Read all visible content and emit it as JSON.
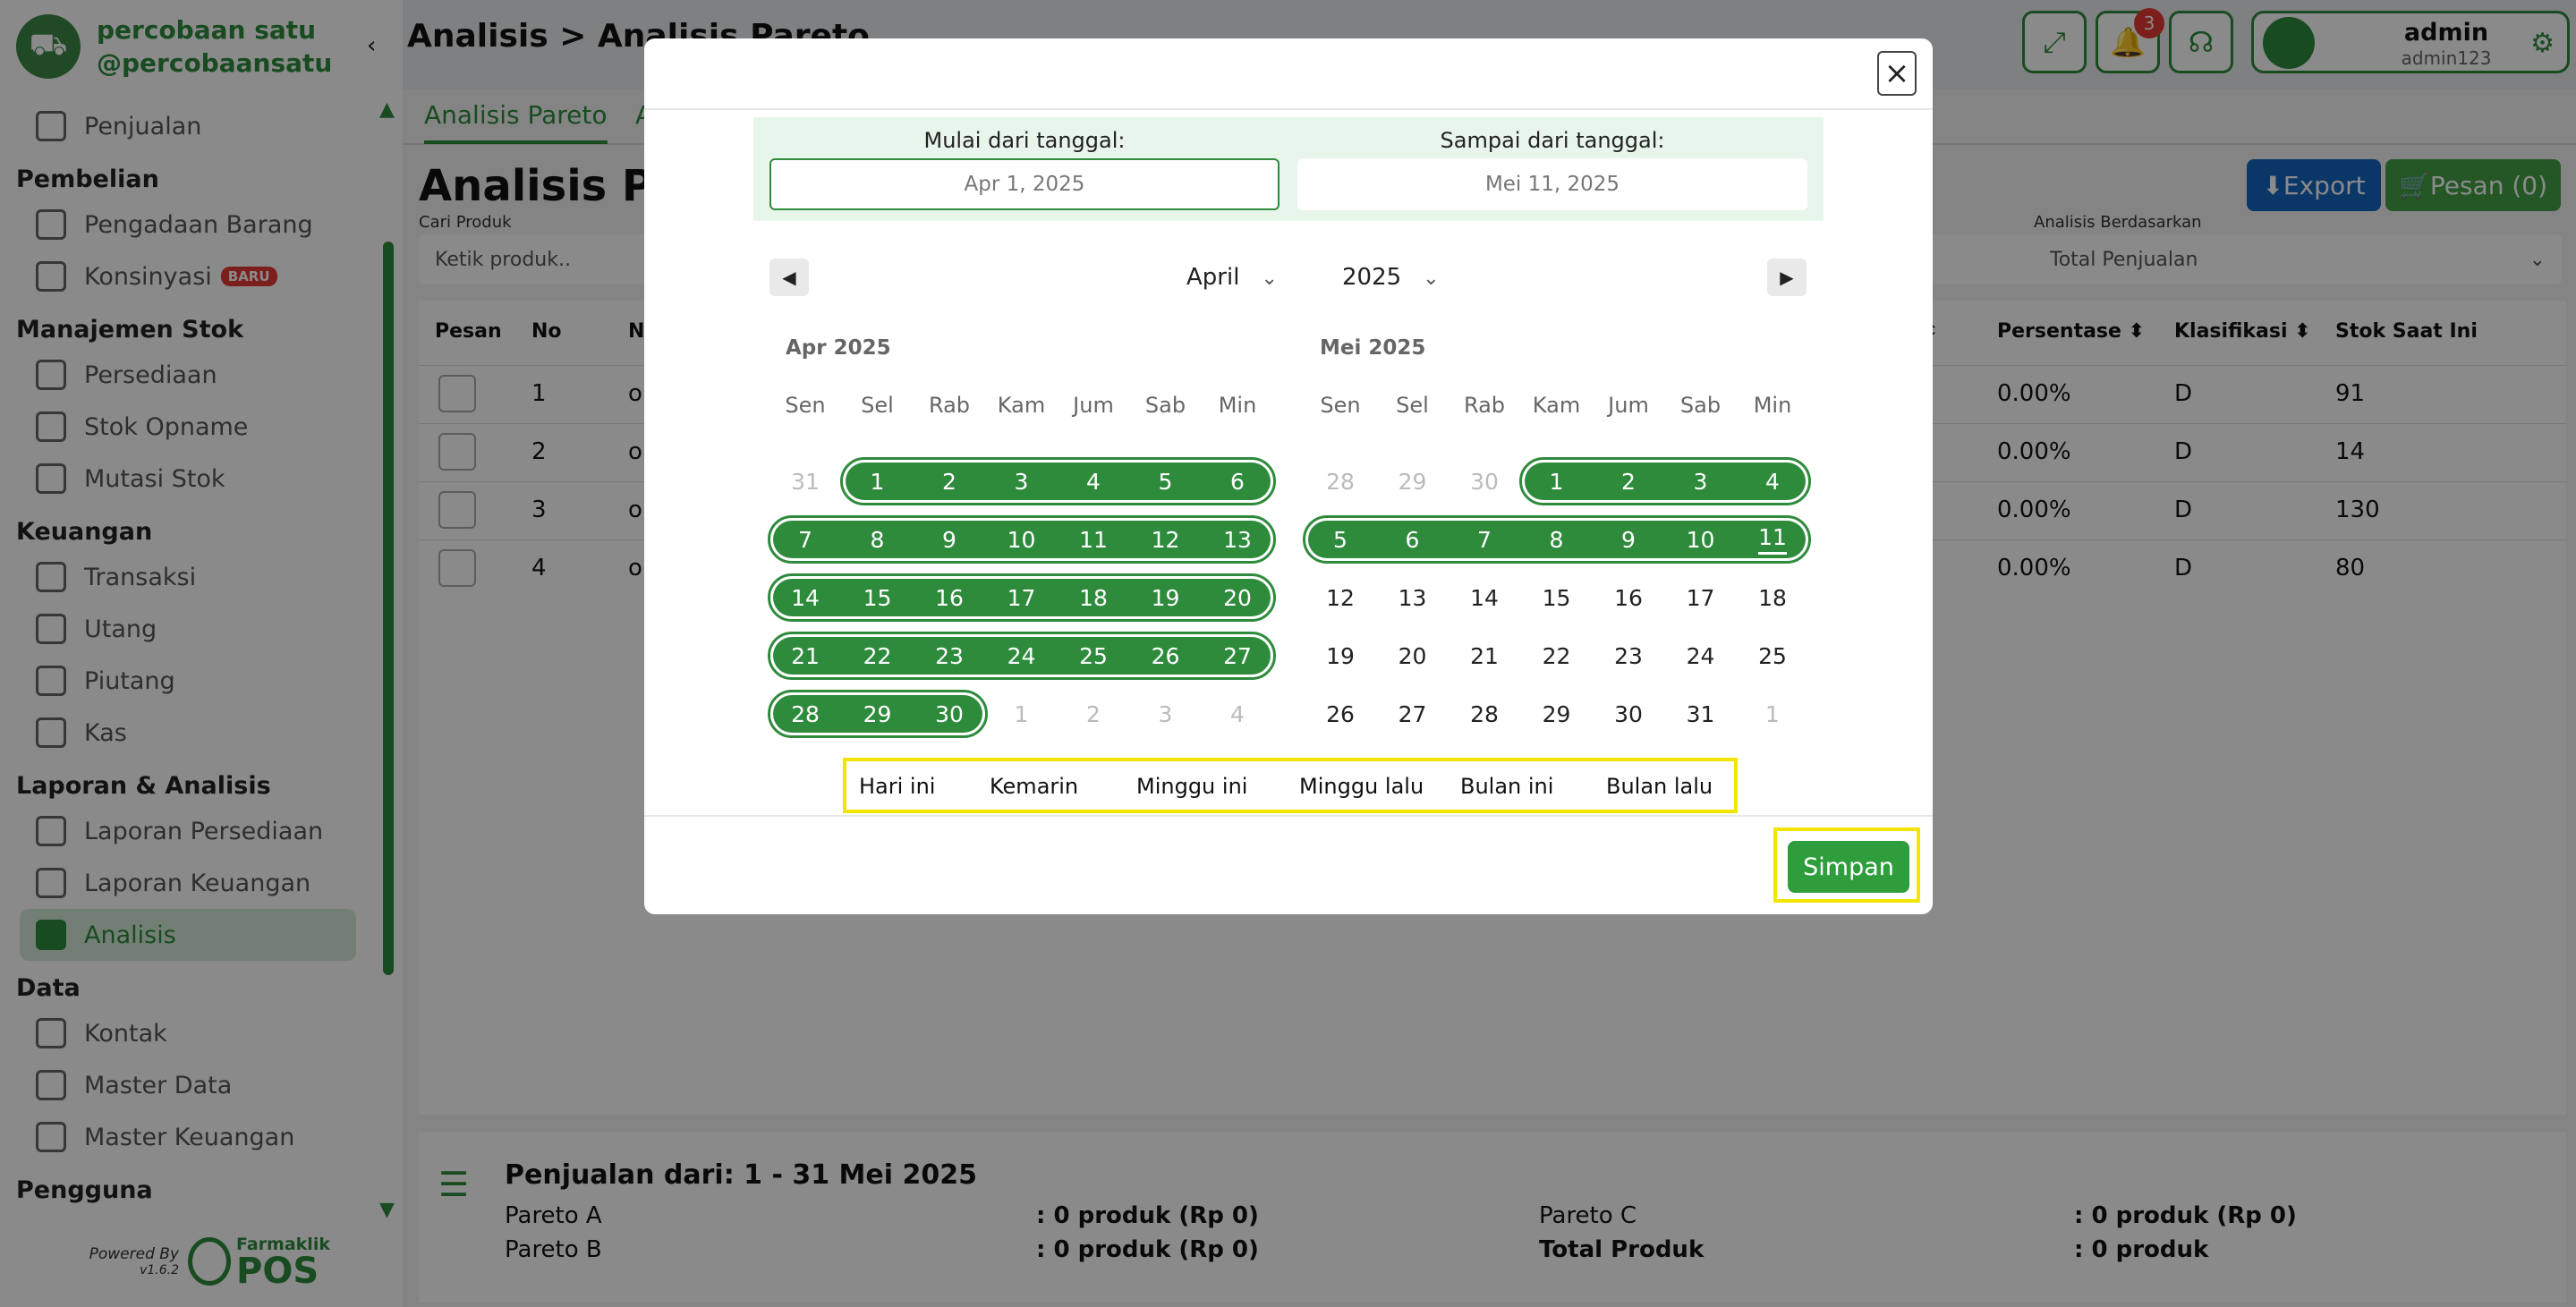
{
  "app": {
    "name": "percobaan satu",
    "handle": "@percobaansatu",
    "version": "v1.6.2"
  },
  "sidebar": {
    "items": [
      {
        "type": "item",
        "label": "Penjualan"
      },
      {
        "type": "section",
        "label": "Pembelian"
      },
      {
        "type": "item",
        "label": "Pengadaan Barang"
      },
      {
        "type": "item",
        "label": "Konsinyasi",
        "badge": "BARU"
      },
      {
        "type": "section",
        "label": "Manajemen Stok"
      },
      {
        "type": "item",
        "label": "Persediaan"
      },
      {
        "type": "item",
        "label": "Stok Opname"
      },
      {
        "type": "item",
        "label": "Mutasi Stok"
      },
      {
        "type": "section",
        "label": "Keuangan"
      },
      {
        "type": "item",
        "label": "Transaksi"
      },
      {
        "type": "item",
        "label": "Utang"
      },
      {
        "type": "item",
        "label": "Piutang"
      },
      {
        "type": "item",
        "label": "Kas"
      },
      {
        "type": "section",
        "label": "Laporan & Analisis"
      },
      {
        "type": "item",
        "label": "Laporan Persediaan"
      },
      {
        "type": "item",
        "label": "Laporan Keuangan"
      },
      {
        "type": "item",
        "label": "Analisis",
        "active": true
      },
      {
        "type": "section",
        "label": "Data"
      },
      {
        "type": "item",
        "label": "Kontak"
      },
      {
        "type": "item",
        "label": "Master Data"
      },
      {
        "type": "item",
        "label": "Master Keuangan"
      },
      {
        "type": "section",
        "label": "Pengguna"
      }
    ],
    "powered_by": "Powered By",
    "brand_top": "Farmaklik",
    "brand_pos": "POS"
  },
  "header": {
    "breadcrumb": "Analisis > Analisis Pareto",
    "notif_count": "3",
    "user_name": "admin",
    "user_sub": "admin123"
  },
  "main": {
    "tabs": [
      "Analisis Pareto",
      "A"
    ],
    "title": "Analisis Pareto",
    "export_label": "Export",
    "pesan_label": "Pesan (0)",
    "cari_label": "Cari Produk",
    "cari_placeholder": "Ketik produk..",
    "analisis_label": "Analisis Berdasarkan",
    "analisis_value": "Total Penjualan",
    "columns": [
      "Pesan",
      "No",
      "N",
      "Persentase",
      "Klasifikasi",
      "Stok Saat Ini"
    ],
    "rows": [
      {
        "no": "1",
        "name": "o",
        "persen": "0.00%",
        "klas": "D",
        "stok": "91"
      },
      {
        "no": "2",
        "name": "o",
        "persen": "0.00%",
        "klas": "D",
        "stok": "14"
      },
      {
        "no": "3",
        "name": "o",
        "persen": "0.00%",
        "klas": "D",
        "stok": "130"
      },
      {
        "no": "4",
        "name": "o",
        "persen": "0.00%",
        "klas": "D",
        "stok": "80"
      }
    ],
    "summary": {
      "title": "Penjualan dari: 1 - 31 Mei 2025",
      "pareto_a": "Pareto A",
      "pareto_a_val": ": 0 produk (Rp 0)",
      "pareto_b": "Pareto B",
      "pareto_b_val": ": 0 produk (Rp 0)",
      "pareto_c": "Pareto C",
      "pareto_c_val": ": 0 produk (Rp 0)",
      "total": "Total Produk",
      "total_val": ": 0 produk"
    }
  },
  "modal": {
    "close": "×",
    "start_label": "Mulai dari tanggal:",
    "start_value": "Apr 1, 2025",
    "end_label": "Sampai dari tanggal:",
    "end_value": "Mei 11, 2025",
    "month_select": "April",
    "year_select": "2025",
    "weekdays": [
      "Sen",
      "Sel",
      "Rab",
      "Kam",
      "Jum",
      "Sab",
      "Min"
    ],
    "left_title": "Apr 2025",
    "right_title": "Mei 2025",
    "quick_ranges": [
      "Hari ini",
      "Kemarin",
      "Minggu ini",
      "Minggu lalu",
      "Bulan ini",
      "Bulan lalu"
    ],
    "save_label": "Simpan"
  },
  "calendar_left": [
    [
      "31",
      "1",
      "2",
      "3",
      "4",
      "5",
      "6"
    ],
    [
      "7",
      "8",
      "9",
      "10",
      "11",
      "12",
      "13"
    ],
    [
      "14",
      "15",
      "16",
      "17",
      "18",
      "19",
      "20"
    ],
    [
      "21",
      "22",
      "23",
      "24",
      "25",
      "26",
      "27"
    ],
    [
      "28",
      "29",
      "30",
      "1",
      "2",
      "3",
      "4"
    ]
  ],
  "calendar_right": [
    [
      "28",
      "29",
      "30",
      "1",
      "2",
      "3",
      "4"
    ],
    [
      "5",
      "6",
      "7",
      "8",
      "9",
      "10",
      "11"
    ],
    [
      "12",
      "13",
      "14",
      "15",
      "16",
      "17",
      "18"
    ],
    [
      "19",
      "20",
      "21",
      "22",
      "23",
      "24",
      "25"
    ],
    [
      "26",
      "27",
      "28",
      "29",
      "30",
      "31",
      "1"
    ]
  ],
  "colors": {
    "accent": "#2e8b3c",
    "highlight": "#f2e600",
    "export": "#1565c0"
  }
}
